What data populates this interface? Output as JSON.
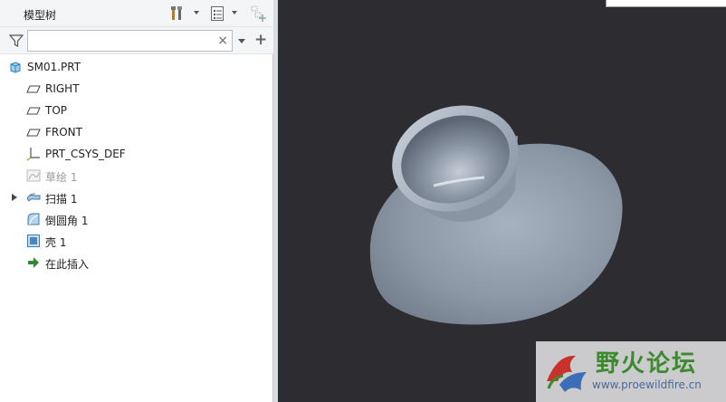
{
  "panel": {
    "title": "模型树",
    "search": {
      "value": "",
      "placeholder": ""
    }
  },
  "tree": {
    "root": {
      "label": "SM01.PRT",
      "icon": "part-icon"
    },
    "items": [
      {
        "label": "RIGHT",
        "icon": "datum-plane-icon",
        "dim": false,
        "expandable": false
      },
      {
        "label": "TOP",
        "icon": "datum-plane-icon",
        "dim": false,
        "expandable": false
      },
      {
        "label": "FRONT",
        "icon": "datum-plane-icon",
        "dim": false,
        "expandable": false
      },
      {
        "label": "PRT_CSYS_DEF",
        "icon": "coordinate-system-icon",
        "dim": false,
        "expandable": false
      },
      {
        "label": "草绘 1",
        "icon": "sketch-icon",
        "dim": true,
        "expandable": false
      },
      {
        "label": "扫描 1",
        "icon": "sweep-icon",
        "dim": false,
        "expandable": true
      },
      {
        "label": "倒圆角 1",
        "icon": "round-icon",
        "dim": false,
        "expandable": false
      },
      {
        "label": "壳 1",
        "icon": "shell-icon",
        "dim": false,
        "expandable": false
      },
      {
        "label": "在此插入",
        "icon": "insert-arrow-icon",
        "dim": false,
        "expandable": false
      }
    ]
  },
  "watermark": {
    "title": "野火论坛",
    "url": "www.proewildfire.cn"
  },
  "colors": {
    "viewport_bg": "#2d2d31",
    "model": "#8e99a8",
    "insert_arrow": "#2e8b2e"
  }
}
